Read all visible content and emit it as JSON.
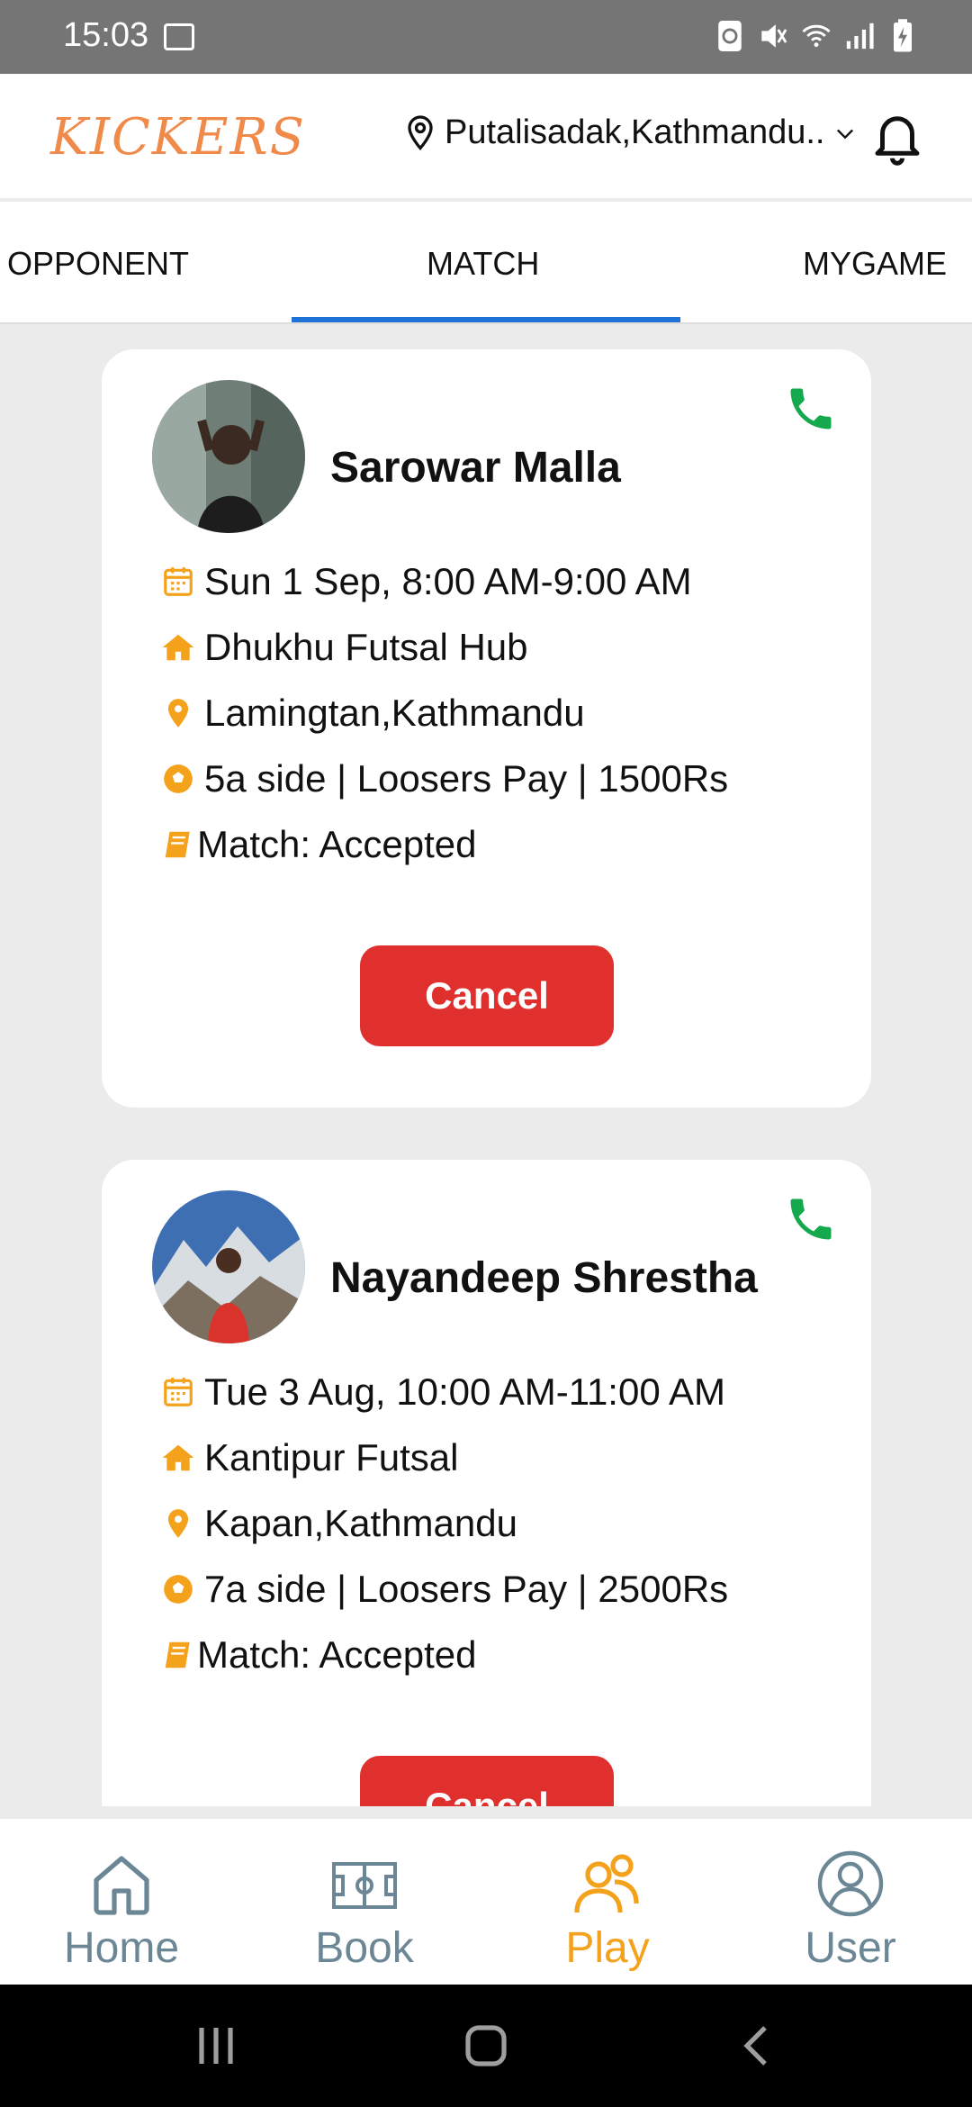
{
  "status_bar": {
    "time": "15:03"
  },
  "header": {
    "logo": "KICKERS",
    "location": "Putalisadak,Kathmandu.."
  },
  "tabs": [
    {
      "label": "OPPONENT"
    },
    {
      "label": "MATCH"
    },
    {
      "label": "MYGAME"
    }
  ],
  "active_tab": "MATCH",
  "matches": [
    {
      "name": "Sarowar Malla",
      "datetime": "Sun 1 Sep, 8:00 AM-9:00 AM",
      "venue": "Dhukhu Futsal Hub",
      "address": "Lamingtan,Kathmandu",
      "details": "5a side | Loosers Pay | 1500Rs",
      "status": "Match: Accepted",
      "button": "Cancel"
    },
    {
      "name": "Nayandeep Shrestha",
      "datetime": "Tue 3 Aug, 10:00 AM-11:00 AM",
      "venue": "Kantipur Futsal",
      "address": "Kapan,Kathmandu",
      "details": "7a side | Loosers Pay | 2500Rs",
      "status": "Match: Accepted",
      "button": "Cancel"
    }
  ],
  "bottom_nav": [
    {
      "label": "Home",
      "icon": "home-icon"
    },
    {
      "label": "Book",
      "icon": "field-icon"
    },
    {
      "label": "Play",
      "icon": "people-icon"
    },
    {
      "label": "User",
      "icon": "user-icon"
    }
  ],
  "active_nav": "Play",
  "colors": {
    "brand": "#f08a4b",
    "accent": "#f4a21c",
    "tab_indicator": "#1e73d9",
    "danger": "#e0302e",
    "phone": "#14a94c",
    "nav_inactive": "#6b8694"
  }
}
